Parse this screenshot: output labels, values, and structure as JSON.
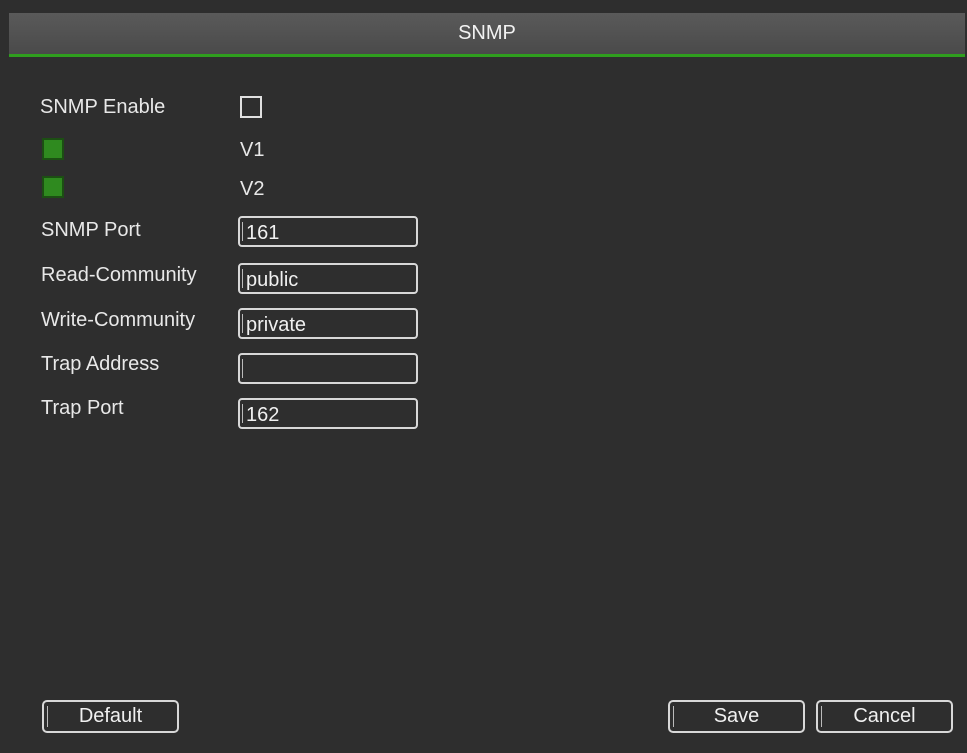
{
  "window": {
    "title": "SNMP"
  },
  "form": {
    "snmp_enable": {
      "label": "SNMP Enable",
      "checked": false
    },
    "v1": {
      "label": "V1",
      "checked": true
    },
    "v2": {
      "label": "V2",
      "checked": true
    },
    "snmp_port": {
      "label": "SNMP Port",
      "value": "161"
    },
    "read_community": {
      "label": "Read-Community",
      "value": "public"
    },
    "write_community": {
      "label": "Write-Community",
      "value": "private"
    },
    "trap_address": {
      "label": "Trap Address",
      "value": ""
    },
    "trap_port": {
      "label": "Trap Port",
      "value": "162"
    }
  },
  "buttons": {
    "default_label": "Default",
    "save_label": "Save",
    "cancel_label": "Cancel"
  },
  "colors": {
    "accent": "#2f9e1e",
    "background": "#2e2e2e",
    "title_bar": "#505050",
    "checked_fill": "#2f8a1f"
  }
}
